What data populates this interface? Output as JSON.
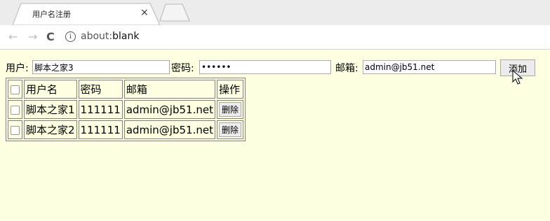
{
  "browser": {
    "tab_title": "用户名注册",
    "tab_close": "×",
    "url_scheme": "about:",
    "url_host": "blank"
  },
  "form": {
    "user_label": "用户:",
    "user_value": "脚本之家3",
    "password_label": "密码:",
    "password_value": "••••••",
    "email_label": "邮箱:",
    "email_value": "admin@jb51.net",
    "add_button": "添加"
  },
  "table": {
    "headers": [
      "用户名",
      "密码",
      "邮箱",
      "操作"
    ],
    "rows": [
      {
        "username": "脚本之家1",
        "password": "111111",
        "email": "admin@jb51.net",
        "action": "删除"
      },
      {
        "username": "脚本之家2",
        "password": "111111",
        "email": "admin@jb51.net",
        "action": "删除"
      }
    ]
  },
  "icons": {
    "back": "back-arrow-icon",
    "forward": "forward-arrow-icon",
    "reload": "reload-icon",
    "info": "info-icon",
    "cursor": "mouse-pointer-icon"
  },
  "colors": {
    "page_background": "#ffffe1"
  }
}
